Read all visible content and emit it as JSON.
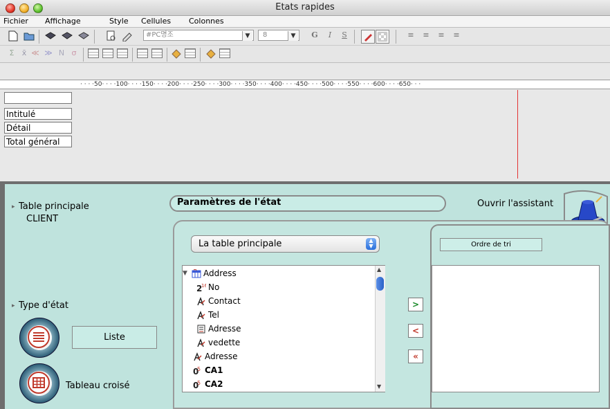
{
  "window": {
    "title": "Etats rapides"
  },
  "menubar": {
    "items": [
      "Fichier",
      "Affichage",
      "Style",
      "Cellules",
      "Colonnes"
    ]
  },
  "toolbar": {
    "font_name": "#PC명조",
    "font_size": "8",
    "bold_label": "G",
    "italic_label": "I",
    "underline_label": "S"
  },
  "ruler": {
    "text": "· · · ·50· · · ·100· · · ·150· · · ·200· · · ·250· · · ·300· · · ·350· · · ·400· · · ·450· · · ·500· · · ·550· · · ·600· · · ·650· · ·"
  },
  "report": {
    "rows": [
      "",
      "Intitulé",
      "Détail",
      "Total général"
    ]
  },
  "left_panel": {
    "table_heading": "Table principale",
    "table_value": "CLIENT",
    "type_heading": "Type d'état",
    "type_list_label": "Liste",
    "type_cross_label": "Tableau croisé"
  },
  "params": {
    "title": "Paramètres de l'état",
    "assistant_label": "Ouvrir l'assistant",
    "table_popup": "La table principale",
    "sort_tab_label": "Ordre de tri"
  },
  "fields": [
    {
      "label": "Address",
      "icon": "table-icon",
      "indent": 0,
      "bold": false,
      "expander": "▼"
    },
    {
      "label": "No",
      "icon": "numeric-field-icon",
      "indent": 1,
      "bold": false
    },
    {
      "label": "Contact",
      "icon": "text-field-icon",
      "indent": 1,
      "bold": false
    },
    {
      "label": "Tel",
      "icon": "text-field-icon",
      "indent": 1,
      "bold": false
    },
    {
      "label": "Adresse",
      "icon": "subtable-icon",
      "indent": 1,
      "bold": false
    },
    {
      "label": "vedette",
      "icon": "text-field-icon",
      "indent": 1,
      "bold": false
    },
    {
      "label": "Adresse",
      "icon": "text-field-icon",
      "indent": 0,
      "bold": false
    },
    {
      "label": "CA1",
      "icon": "real-field-icon",
      "indent": 0,
      "bold": true
    },
    {
      "label": "CA2",
      "icon": "real-field-icon",
      "indent": 0,
      "bold": true
    }
  ],
  "move_buttons": [
    ">",
    "<",
    "«"
  ],
  "colors": {
    "panel": "#bfe3dd",
    "accent_green": "#1a8a2a",
    "accent_red": "#c0392b",
    "ruler_marker": "#e43333"
  }
}
